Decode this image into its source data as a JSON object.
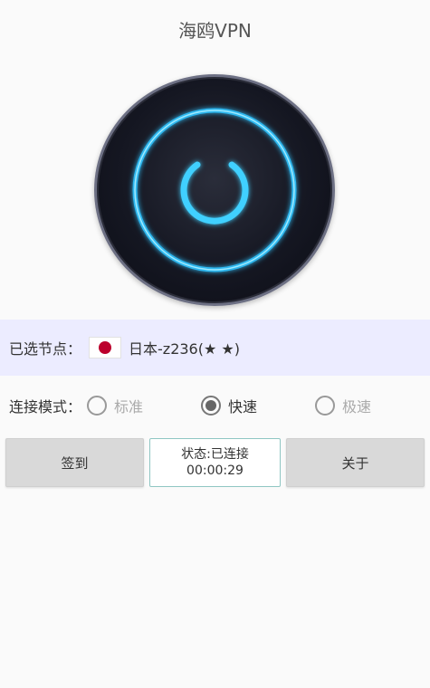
{
  "app": {
    "title": "海鸥VPN"
  },
  "node": {
    "label": "已选节点：",
    "name": "日本-z236(★ ★)"
  },
  "mode": {
    "label": "连接模式：",
    "options": [
      {
        "label": "标准",
        "selected": false,
        "enabled": false
      },
      {
        "label": "快速",
        "selected": true,
        "enabled": true
      },
      {
        "label": "极速",
        "selected": false,
        "enabled": false
      }
    ]
  },
  "buttons": {
    "checkin": "签到",
    "about": "关于"
  },
  "status": {
    "text": "状态:已连接",
    "time": "00:00:29"
  },
  "colors": {
    "power_glow": "#3fd0ff",
    "node_bar_bg": "#ececff",
    "flag_red": "#bc002d"
  }
}
